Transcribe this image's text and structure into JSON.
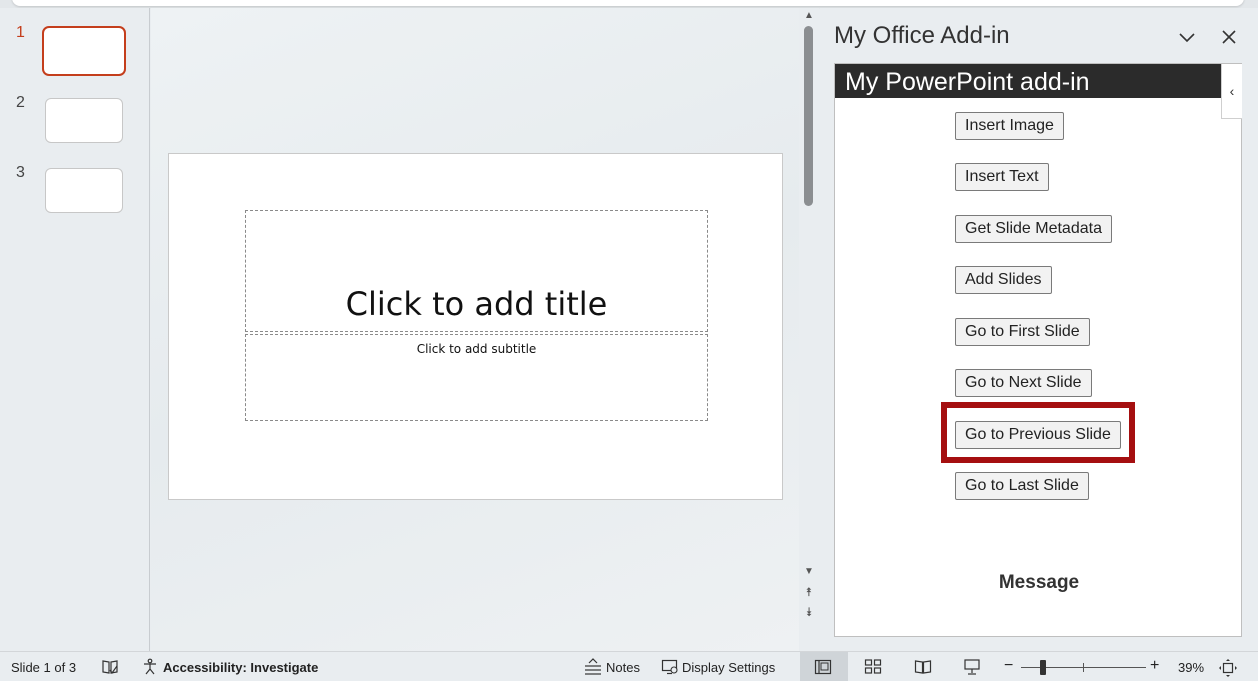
{
  "thumbnails": [
    {
      "number": "1",
      "active": true
    },
    {
      "number": "2",
      "active": false
    },
    {
      "number": "3",
      "active": false
    }
  ],
  "slide": {
    "title_placeholder": "Click to add title",
    "subtitle_placeholder": "Click to add subtitle"
  },
  "taskpane": {
    "title": "My Office Add-in",
    "addin_header": "My PowerPoint add-in",
    "buttons": {
      "insert_image": "Insert Image",
      "insert_text": "Insert Text",
      "get_slide_metadata": "Get Slide Metadata",
      "add_slides": "Add Slides",
      "go_first": "Go to First Slide",
      "go_next": "Go to Next Slide",
      "go_previous": "Go to Previous Slide",
      "go_last": "Go to Last Slide"
    },
    "message_heading": "Message"
  },
  "statusbar": {
    "slide_count": "Slide 1 of 3",
    "accessibility": "Accessibility: Investigate",
    "notes": "Notes",
    "display_settings": "Display Settings",
    "zoom": "39%"
  },
  "colors": {
    "accent": "#c43e1c",
    "highlight": "#a50f10",
    "addin_header_bg": "#2b2b2b"
  }
}
